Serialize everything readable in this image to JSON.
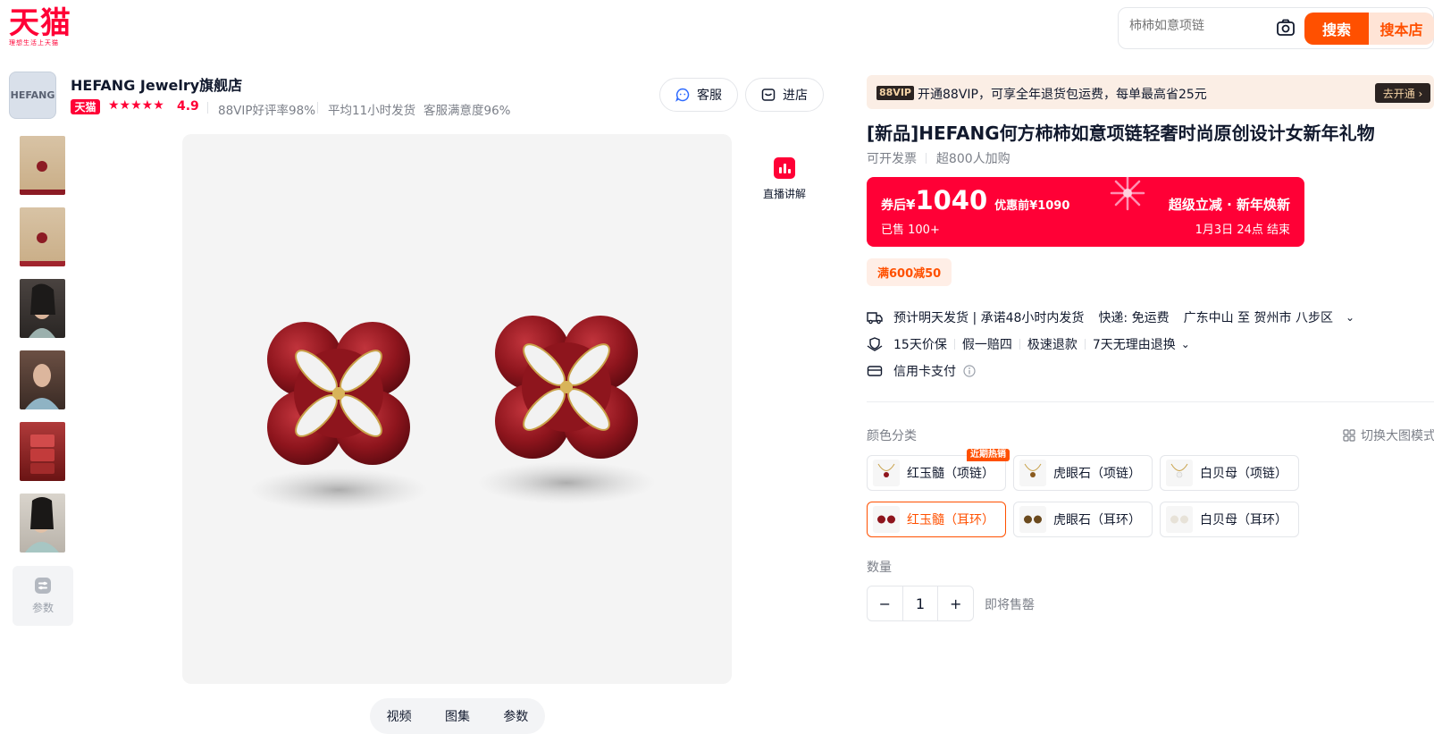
{
  "header": {
    "logo": "天猫",
    "logo_sub": "理想生活上天猫",
    "search_placeholder": "柿柿如意项链",
    "camera_icon": "camera-icon",
    "search_label": "搜索",
    "shop_search_label": "搜本店"
  },
  "shop": {
    "logo_text": "HEFANG",
    "name": "HEFANG Jewelry旗舰店",
    "arrow": "›",
    "tag": "天猫",
    "stars": "★★★★★",
    "rating": "4.9",
    "stat_good_rate": "88VIP好评率98%",
    "stat_ship_time": "平均11小时发货",
    "stat_satisfaction": "客服满意度96%",
    "service_label": "客服",
    "enter_label": "进店"
  },
  "gallery": {
    "params_label": "参数",
    "live_label": "直播讲解",
    "tabs": [
      "视频",
      "图集",
      "参数"
    ]
  },
  "vip": {
    "badge": "88VIP",
    "text": "开通88VIP，可享全年退货包运费，每单最高省25元",
    "action": "去开通 ›"
  },
  "product": {
    "title": "[新品]HEFANG何方柿柿如意项链轻奢时尚原创设计女新年礼物",
    "invoice": "可开发票",
    "purchased": "超800人加购"
  },
  "price": {
    "prefix": "券后",
    "currency": "¥",
    "amount": "1040",
    "original": "优惠前¥1090",
    "sold": "已售 100+",
    "promo_title": "超级立减 · 新年焕新",
    "promo_end": "1月3日 24点  结束",
    "colors": {
      "card": "#ff0036",
      "accent": "#ff5000"
    }
  },
  "coupon": {
    "label": "满600减50"
  },
  "delivery": {
    "ship": "预计明天发货 | 承诺48小时内发货",
    "express": "快递: 免运费",
    "route": "广东中山 至 贺州市 八步区",
    "guarantees": [
      "15天价保",
      "假一赔四",
      "极速退款",
      "7天无理由退换"
    ],
    "payment": "信用卡支付"
  },
  "sku": {
    "label": "颜色分类",
    "view_toggle": "切换大图模式",
    "hot_tag": "近期热销",
    "options": [
      {
        "label": "红玉髓（项链）",
        "selected": false
      },
      {
        "label": "虎眼石（项链）",
        "selected": false
      },
      {
        "label": "白贝母（项链）",
        "selected": false
      },
      {
        "label": "红玉髓（耳环）",
        "selected": true
      },
      {
        "label": "虎眼石（耳环）",
        "selected": false
      },
      {
        "label": "白贝母（耳环）",
        "selected": false
      }
    ]
  },
  "quantity": {
    "label": "数量",
    "minus": "−",
    "value": "1",
    "plus": "+",
    "status": "即将售罄"
  }
}
